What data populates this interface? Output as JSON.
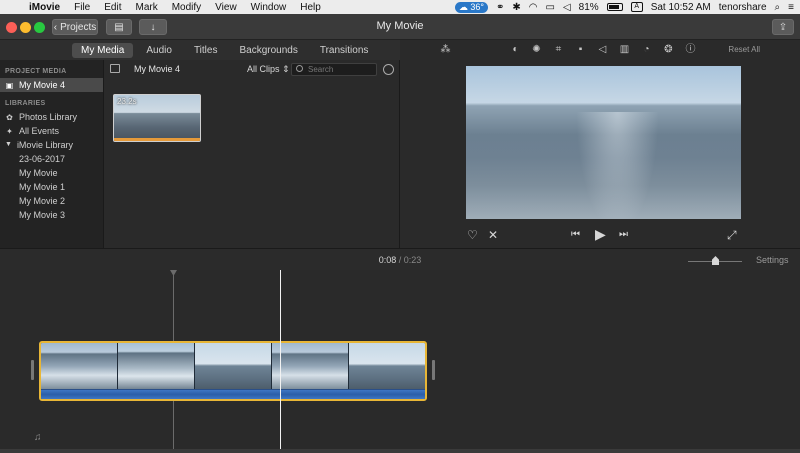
{
  "menubar": {
    "app_name": "iMovie",
    "items": [
      "File",
      "Edit",
      "Mark",
      "Modify",
      "View",
      "Window",
      "Help"
    ],
    "cloud_badge": "36°",
    "battery_pct": "81%",
    "clock": "Sat 10:52 AM",
    "user": "tenorshare",
    "tray_a": "A"
  },
  "toolbar": {
    "projects_label": "Projects",
    "window_title": "My Movie"
  },
  "tabs": [
    "My Media",
    "Audio",
    "Titles",
    "Backgrounds",
    "Transitions"
  ],
  "sidebar": {
    "project_media_heading": "PROJECT MEDIA",
    "project_item": "My Movie 4",
    "libraries_heading": "LIBRARIES",
    "photos_library": "Photos Library",
    "all_events": "All Events",
    "imovie_library": "iMovie Library",
    "events": [
      "23-06-2017",
      "My Movie",
      "My Movie 1",
      "My Movie 2",
      "My Movie 3"
    ]
  },
  "browser": {
    "library_name": "My Movie 4",
    "filter_label": "All Clips",
    "search_placeholder": "Search",
    "clip_duration": "23.2s"
  },
  "viewer": {
    "reset_all": "Reset All"
  },
  "timeline": {
    "current_time": "0:08",
    "total_time": "0:23",
    "separator": "/",
    "settings_label": "Settings"
  },
  "icons": {
    "magic_wand": "magic-wand-icon",
    "color_balance": "color-balance-icon",
    "color_correction": "color-correction-icon",
    "crop": "crop-icon",
    "stabilization": "stabilization-icon",
    "volume": "volume-icon",
    "noise_reduction": "noise-reduction-icon",
    "speed": "speed-icon",
    "filter": "clip-filter-icon",
    "info": "info-icon"
  },
  "colors": {
    "accent_clip_border": "#e8b636",
    "audio_blue": "#3f77c4",
    "selected_tab": "#4d4d4d"
  }
}
